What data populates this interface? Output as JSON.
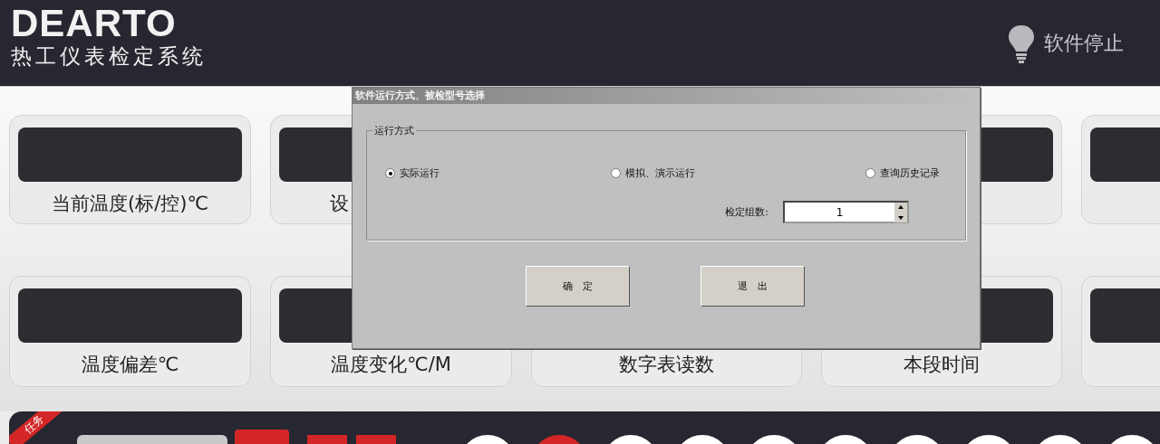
{
  "header": {
    "logo": "DEARTO",
    "subtitle": "热工仪表检定系统",
    "status": {
      "label": "软件停止",
      "running": false
    }
  },
  "cards": [
    [
      {
        "kind": "gauge",
        "label": "当前温度(标/控)℃",
        "clipped": false
      },
      {
        "kind": "gauge",
        "label": "设",
        "clipped": true
      },
      {
        "kind": "covered"
      },
      {
        "kind": "gauge"
      },
      {
        "kind": "gauge"
      }
    ],
    [
      {
        "kind": "gauge",
        "label": "温度偏差℃",
        "clipped": false
      },
      {
        "kind": "gauge",
        "label": "温度变化℃/M",
        "clipped": false
      },
      {
        "kind": "label",
        "label": "数字表读数",
        "clipped": false
      },
      {
        "kind": "gauge",
        "label": "本段时间",
        "clipped": false
      },
      {
        "kind": "gauge"
      }
    ]
  ],
  "dialog": {
    "title": "软件运行方式、被检型号选择",
    "group": {
      "legend": "运行方式",
      "options": [
        {
          "label": "实际运行",
          "selected": true
        },
        {
          "label": "模拟、演示运行",
          "selected": false
        },
        {
          "label": "查询历史记录",
          "selected": false
        }
      ],
      "count": {
        "label": "检定组数:",
        "value": "1"
      }
    },
    "buttons": [
      "确　定",
      "退　出"
    ]
  },
  "task_bar": {
    "ribbon": "任务",
    "circles": [
      {
        "active": false
      },
      {
        "active": true
      },
      {
        "active": false
      },
      {
        "active": false
      },
      {
        "active": false
      },
      {
        "active": false
      },
      {
        "active": false
      },
      {
        "active": false
      },
      {
        "active": false
      },
      {
        "active": false
      }
    ]
  }
}
